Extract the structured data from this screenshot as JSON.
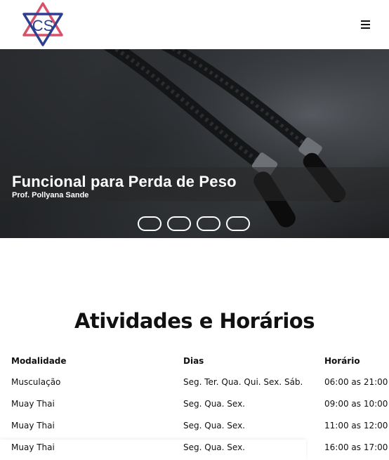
{
  "header": {
    "logo_text": "CS",
    "menu_icon": "hamburger-menu-icon"
  },
  "hero": {
    "title": "Funcional para Perda de Peso",
    "subtitle": "Prof. Pollyana Sande",
    "slide_count": 4
  },
  "schedule": {
    "title": "Atividades e Horários",
    "columns": [
      "Modalidade",
      "Dias",
      "Horário"
    ],
    "rows": [
      [
        "Musculação",
        "Seg. Ter. Qua. Qui. Sex. Sáb.",
        "06:00 as 21:00"
      ],
      [
        "Muay Thai",
        "Seg. Qua. Sex.",
        "09:00 as 10:00"
      ],
      [
        "Muay Thai",
        "Seg. Qua. Sex.",
        "11:00 as 12:00"
      ],
      [
        "Muay Thai",
        "Seg. Qua. Sex.",
        "16:00 as 17:00"
      ]
    ]
  },
  "colors": {
    "logo_red": "#d9506a",
    "logo_blue": "#2f3f8f",
    "hero_band": "#282828"
  }
}
